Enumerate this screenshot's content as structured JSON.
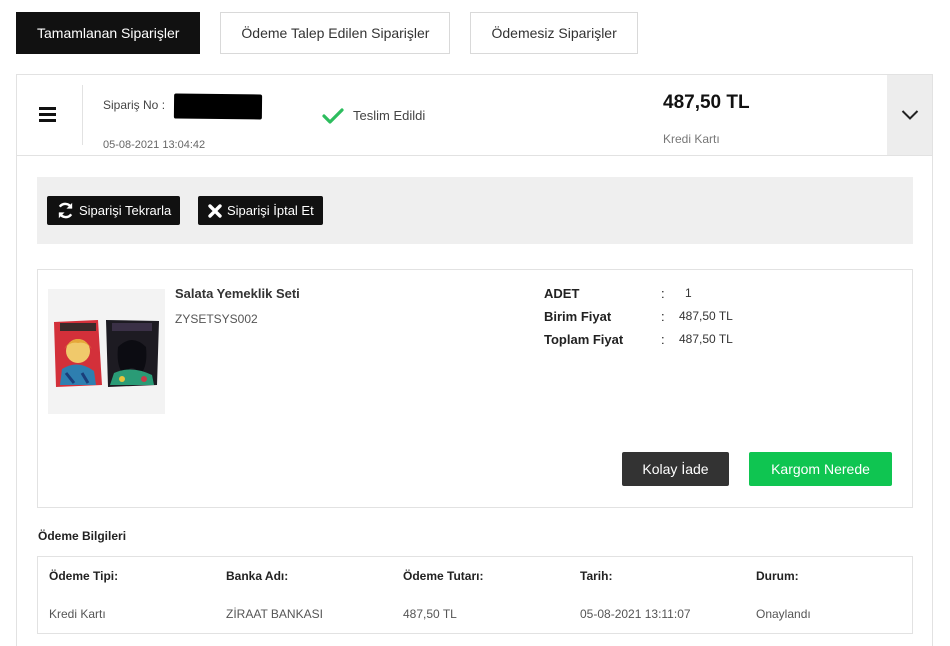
{
  "tabs": [
    {
      "label": "Tamamlanan Siparişler",
      "active": true
    },
    {
      "label": "Ödeme Talep Edilen Siparişler",
      "active": false
    },
    {
      "label": "Ödemesiz Siparişler",
      "active": false
    }
  ],
  "order": {
    "number_label": "Sipariş No :",
    "date": "05-08-2021 13:04:42",
    "status": "Teslim Edildi",
    "total": "487,50 TL",
    "payment_type": "Kredi Kartı"
  },
  "actions": {
    "repeat_label": "Siparişi Tekrarla",
    "cancel_label": "Siparişi İptal Et"
  },
  "product": {
    "name": "Salata Yemeklik Seti",
    "code": "ZYSETSYS002",
    "details": [
      {
        "key": "ADET",
        "sep": ":",
        "value": "1"
      },
      {
        "key": "Birim Fiyat",
        "sep": ":",
        "value": "487,50 TL"
      },
      {
        "key": "Toplam Fiyat",
        "sep": ":",
        "value": "487,50 TL"
      }
    ],
    "return_label": "Kolay İade",
    "track_label": "Kargom Nerede"
  },
  "payment": {
    "title": "Ödeme Bilgileri",
    "columns": [
      {
        "header": "Ödeme Tipi:",
        "value": "Kredi Kartı"
      },
      {
        "header": "Banka Adı:",
        "value": "ZİRAAT BANKASI"
      },
      {
        "header": "Ödeme Tutarı:",
        "value": "487,50 TL"
      },
      {
        "header": "Tarih:",
        "value": "05-08-2021 13:11:07"
      },
      {
        "header": "Durum:",
        "value": "Onaylandı"
      }
    ]
  },
  "colors": {
    "primary_dark": "#111111",
    "success_green": "#0fc551",
    "return_button": "#333333",
    "check_green": "#2dbd5e"
  },
  "icons": [
    "menu-icon",
    "check-icon",
    "chevron-down-icon",
    "refresh-icon",
    "close-icon"
  ]
}
